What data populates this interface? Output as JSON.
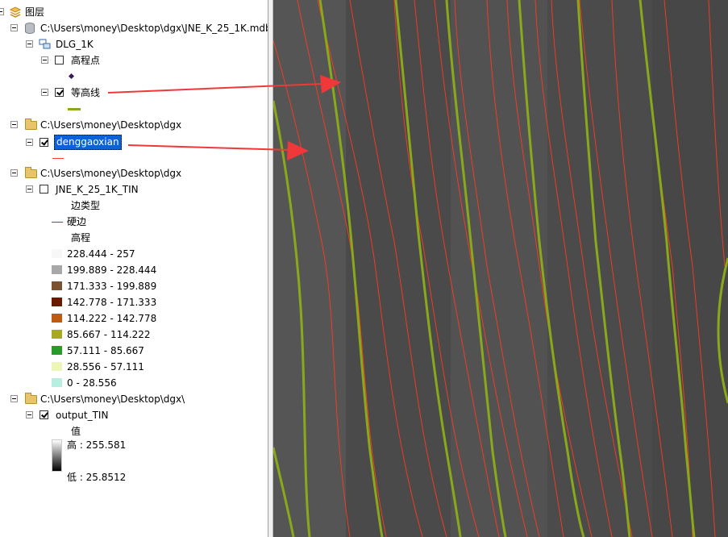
{
  "toc": {
    "root_label": "图层",
    "layers": {
      "mdb_path": "C:\\Users\\money\\Desktop\\dgx\\JNE_K_25_1K.mdb",
      "dataset": "DLG_1K",
      "elev_points": "高程点",
      "contours": "等高线",
      "folder1": "C:\\Users\\money\\Desktop\\dgx",
      "dgx_layer": "denggaoxian",
      "folder2": "C:\\Users\\money\\Desktop\\dgx",
      "tin_layer": "JNE_K_25_1K_TIN",
      "edge_type_heading": "边类型",
      "hard_edge": "硬边",
      "elevation_heading": "高程",
      "elevation_classes": [
        {
          "label": "228.444 - 257",
          "color": "#f7f7f7"
        },
        {
          "label": "199.889 - 228.444",
          "color": "#a8a8a8"
        },
        {
          "label": "171.333 - 199.889",
          "color": "#7a5230"
        },
        {
          "label": "142.778 - 171.333",
          "color": "#6b1a00"
        },
        {
          "label": "114.222 - 142.778",
          "color": "#c05a10"
        },
        {
          "label": "85.667 - 114.222",
          "color": "#a8a822"
        },
        {
          "label": "57.111 - 85.667",
          "color": "#2a9a2a"
        },
        {
          "label": "28.556 - 57.111",
          "color": "#eef5b8"
        },
        {
          "label": "0 - 28.556",
          "color": "#b6eee2"
        }
      ],
      "folder3": "C:\\Users\\money\\Desktop\\dgx\\",
      "output_layer": "output_TIN",
      "value_heading": "值",
      "high_label": "高 : 255.581",
      "low_label": "低 : 25.8512"
    }
  },
  "colors": {
    "map_bg": "#4d4d4d",
    "contour_green": "#8aa91a",
    "contour_red": "#ff3b1f",
    "arrow": "#f0383a",
    "selection": "#0a62d6"
  }
}
